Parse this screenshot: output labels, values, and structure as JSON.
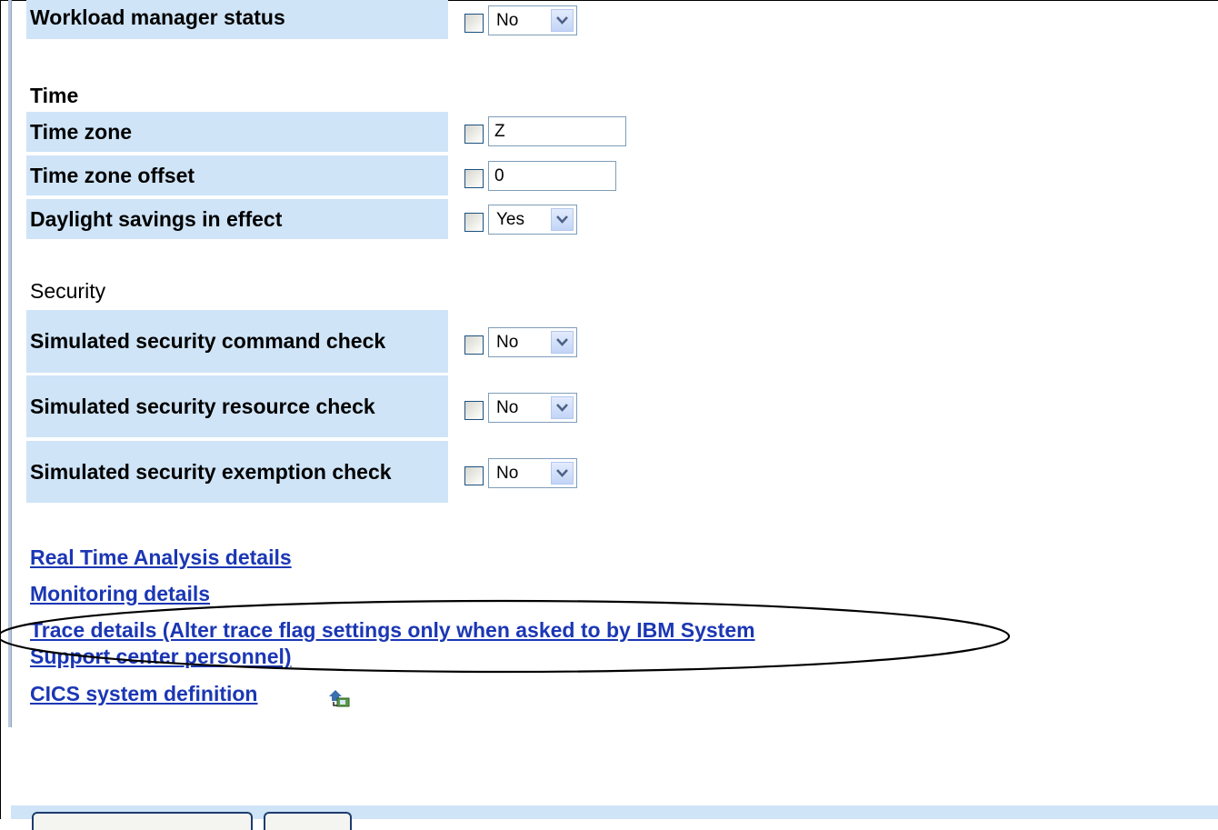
{
  "rows": [
    {
      "label": "Workload manager status",
      "control": "select",
      "value": "No"
    },
    {
      "label": "Time zone",
      "control": "text",
      "value": "Z"
    },
    {
      "label": "Time zone offset",
      "control": "text",
      "value": "0"
    },
    {
      "label": "Daylight savings in effect",
      "control": "select",
      "value": "Yes"
    },
    {
      "label": "Simulated security command check",
      "control": "select",
      "value": "No"
    },
    {
      "label": "Simulated security resource check",
      "control": "select",
      "value": "No"
    },
    {
      "label": "Simulated security exemption check",
      "control": "select",
      "value": "No"
    }
  ],
  "headings": {
    "time": "Time",
    "security": "Security"
  },
  "links": {
    "rta": "Real Time Analysis details",
    "monitoring": "Monitoring details",
    "trace_line1": "Trace details (Alter trace flag settings only when asked to by IBM System",
    "trace_line2": "Support center personnel)",
    "cics": "CICS system definition"
  },
  "icons": {
    "cics_link_icon": "hierarchy-navigate-icon"
  },
  "colors": {
    "label_bg": "#cfe4f7",
    "link": "#1b37b4",
    "annotation": "#000000"
  }
}
